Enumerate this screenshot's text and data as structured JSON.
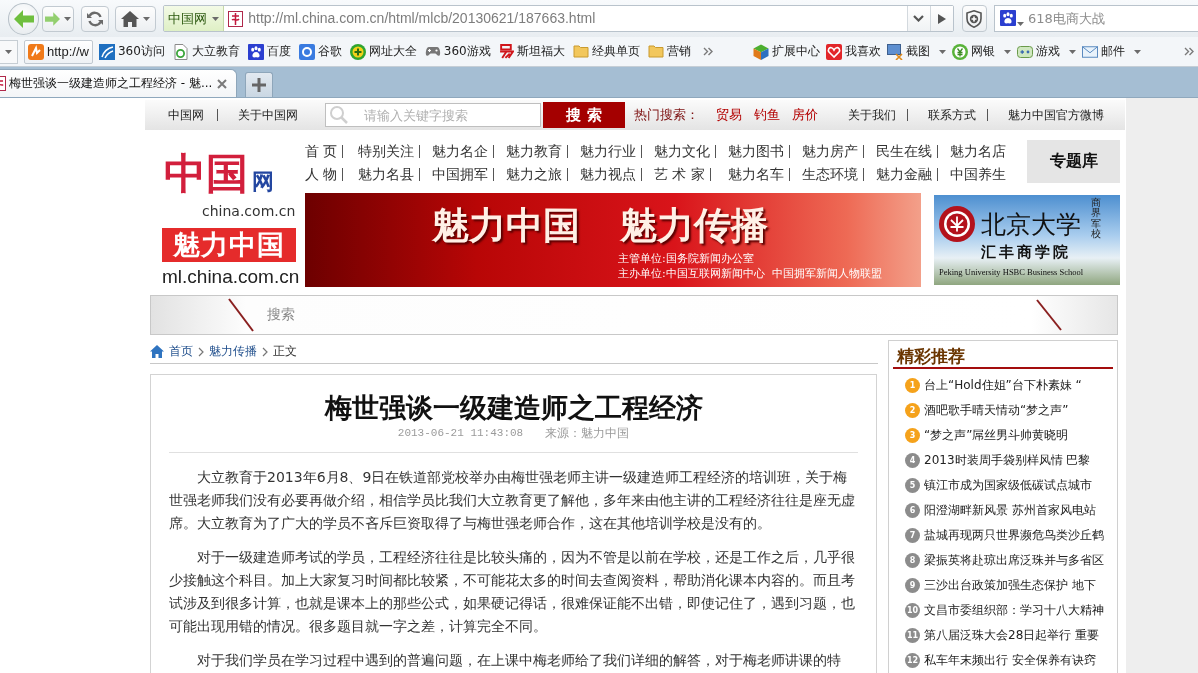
{
  "browser": {
    "site_menu": "中国网",
    "address": "http://ml.china.com.cn/html/mlcb/20130621/187663.html",
    "search": {
      "placeholder": "618电商大战"
    },
    "bookmarks": [
      {
        "label": "http://w",
        "boxed": true
      },
      {
        "label": "360访问",
        "boxed": false
      },
      {
        "label": "大立教育",
        "boxed": false
      },
      {
        "label": "百度",
        "boxed": false
      },
      {
        "label": "谷歌",
        "boxed": false
      },
      {
        "label": "网址大全",
        "boxed": false
      },
      {
        "label": "360游戏",
        "boxed": false
      },
      {
        "label": "斯坦福大",
        "boxed": false
      },
      {
        "label": "经典单页",
        "boxed": false
      },
      {
        "label": "营销",
        "boxed": false
      }
    ],
    "tools": [
      {
        "label": "扩展中心",
        "has_menu": false
      },
      {
        "label": "我喜欢",
        "has_menu": false
      },
      {
        "label": "截图",
        "has_menu": true
      },
      {
        "label": "网银",
        "has_menu": true
      },
      {
        "label": "游戏",
        "has_menu": true
      },
      {
        "label": "邮件",
        "has_menu": true
      }
    ],
    "tabs": [
      {
        "title": "梅世强谈一级建造师之工程经济 - 魅...",
        "selected": true
      }
    ]
  },
  "top_bar": {
    "links": [
      "中国网",
      "关于中国网"
    ],
    "search": {
      "placeholder": "请输入关键字搜索",
      "button": "搜 索"
    },
    "hot_search": {
      "label": "热门搜索：",
      "terms": [
        "贸易",
        "钓鱼",
        "房价"
      ]
    },
    "info_links": [
      "关于我们",
      "联系方式",
      "魅力中国官方微博"
    ]
  },
  "logo": {
    "mark": "中国",
    "mark_suffix": "网",
    "domain": "china.com.cn",
    "title": "魅力中国",
    "subdomain": "ml.china.com.cn"
  },
  "nav": {
    "rows": [
      [
        "首 页",
        "特别关注",
        "魅力名企",
        "魅力教育",
        "魅力行业",
        "魅力文化",
        "魅力图书",
        "魅力房产",
        "民生在线",
        "魅力名店"
      ],
      [
        "人 物",
        "魅力名县",
        "中国拥军",
        "魅力之旅",
        "魅力视点",
        "艺 术 家",
        "魅力名车",
        "生态环境",
        "魅力金融",
        "中国养生"
      ]
    ],
    "topics_button": "专题库"
  },
  "banner": {
    "slogans": [
      "魅力中国",
      "魅力传播"
    ],
    "lines": [
      "主管单位:国务院新闻办公室",
      "主办单位:中国互联网新闻中心  中国拥军新闻人物联盟"
    ]
  },
  "ad": {
    "title": "北京大学",
    "vertical": "商界军校",
    "subtitle": "汇丰商学院",
    "english": "Peking University HSBC Business School"
  },
  "subnav": {
    "label": "搜索"
  },
  "breadcrumb": [
    {
      "label": "首页",
      "kind": "link"
    },
    {
      "label": "魅力传播",
      "kind": "link"
    },
    {
      "label": "正文",
      "kind": "current"
    }
  ],
  "article": {
    "title": "梅世强谈一级建造师之工程经济",
    "date": "2013-06-21 11:43:08",
    "source": "来源：魅力中国",
    "paragraphs": [
      "大立教育于2013年6月8、9日在铁道部党校举办由梅世强老师主讲一级建造师工程经济的培训班，关于梅世强老师我们没有必要再做介绍，相信学员比我们大立教育更了解他，多年来由他主讲的工程经济往往是座无虚席。大立教育为了广大的学员不吝斥巨资取得了与梅世强老师合作，这在其他培训学校是没有的。",
      "对于一级建造师考试的学员，工程经济往往是比较头痛的，因为不管是以前在学校，还是工作之后，几乎很少接触这个科目。加上大家复习时间都比较紧，不可能花太多的时间去查阅资料，帮助消化课本内容的。而且考试涉及到很多计算，也就是课本上的那些公式，如果硬记得话，很难保证能不出错，即使记住了，遇到习题，也可能出现用错的情况。很多题目就一字之差，计算完全不同。",
      "对于我们学员在学习过程中遇到的普遍问题，在上课中梅老师给了我们详细的解答，对于梅老师讲课的特"
    ]
  },
  "recommendations": {
    "title": "精彩推荐",
    "items": [
      {
        "rank": "1",
        "text": "台上“Hold住姐”台下朴素妹 “",
        "color": "#f5a21b"
      },
      {
        "rank": "2",
        "text": "酒吧歌手晴天情动“梦之声”",
        "color": "#f5a21b"
      },
      {
        "rank": "3",
        "text": "“梦之声”屌丝男斗帅黄晓明",
        "color": "#f5a21b"
      },
      {
        "rank": "4",
        "text": "2013时装周手袋别样风情 巴黎",
        "color": "#8c8c8c"
      },
      {
        "rank": "5",
        "text": "镇江市成为国家级低碳试点城市",
        "color": "#8c8c8c"
      },
      {
        "rank": "6",
        "text": "阳澄湖畔新风景 苏州首家风电站",
        "color": "#8c8c8c"
      },
      {
        "rank": "7",
        "text": "盐城再现两只世界濒危鸟类沙丘鹤",
        "color": "#8c8c8c"
      },
      {
        "rank": "8",
        "text": "梁振英将赴琼出席泛珠并与多省区",
        "color": "#8c8c8c"
      },
      {
        "rank": "9",
        "text": "三沙出台政策加强生态保护 地下",
        "color": "#8c8c8c"
      },
      {
        "rank": "10",
        "text": "文昌市委组织部：学习十八大精神",
        "color": "#8c8c8c"
      },
      {
        "rank": "11",
        "text": "第八届泛珠大会28日起举行 重要",
        "color": "#8c8c8c"
      },
      {
        "rank": "12",
        "text": "私车年末频出行 安全保养有诀窍",
        "color": "#8c8c8c"
      }
    ]
  }
}
